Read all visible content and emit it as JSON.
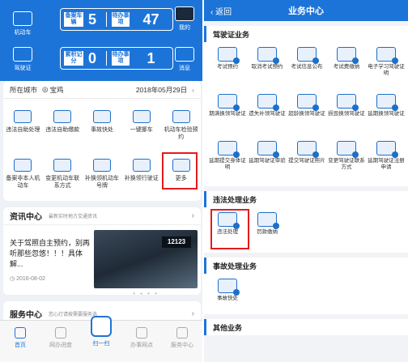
{
  "left": {
    "car_label": "机动车",
    "license_label": "驾驶证",
    "my_label": "我的",
    "msg_label": "消息",
    "plate1": {
      "label": "备案车辆",
      "count": "5",
      "label2": "待办事项",
      "count2": "47"
    },
    "plate2": {
      "label": "累积记分",
      "count": "0",
      "label2": "待办事项",
      "count2": "1"
    },
    "city_label": "所在城市",
    "city_name": "宝鸡",
    "date": "2018年05月29日",
    "row1": [
      "违法自助处理",
      "违法自助缴款",
      "事故快处",
      "一键挪车",
      "机动车检验预约"
    ],
    "row2": [
      "备案非本人机动车",
      "变更机动车联系方式",
      "补换领机动车号牌",
      "补换领行驶证",
      "更多"
    ],
    "news_title": "资讯中心",
    "news_sub": "最新实时地方交通资讯",
    "news_body": "关于驾照自主预约，别再听那些忽悠！！！具体解...",
    "news_date": "2016-08-02",
    "photo_sign": "12123",
    "service_title": "服务中心",
    "service_sub": "您心灯请按需要服务选",
    "tabs": [
      "首页",
      "网办进度",
      "扫一扫",
      "办事网点",
      "服务中心"
    ]
  },
  "right": {
    "back": "返回",
    "title": "业务中心",
    "sec1": "驾驶证业务",
    "sec1_items": [
      "考试预约",
      "取消考试预约",
      "考试信息公布",
      "考试费缴纳",
      "电子学习驾驶证明",
      "期满换领驾驶证",
      "遗失补领驾驶证",
      "超龄换领驾驶证",
      "损毁换领驾驶证",
      "延期换领驾驶证",
      "延期提交身体证明",
      "延期驾驶证审验",
      "提交驾驶证照片",
      "变更驾驶证联系方式",
      "延期驾驶证注册申请"
    ],
    "sec2": "违法处理业务",
    "sec2_items": [
      "违法处理",
      "罚款缴纳"
    ],
    "sec3": "事故处理业务",
    "sec3_items": [
      "事故快处"
    ],
    "sec4": "其他业务"
  },
  "colors": {
    "brand": "#1d74d8",
    "highlight": "#e51b1b"
  }
}
